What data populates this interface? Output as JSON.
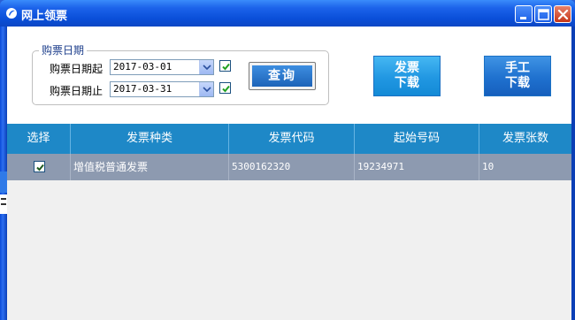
{
  "window": {
    "title": "网上领票",
    "controls": {
      "minimize": "minimize-icon",
      "maximize": "maximize-icon",
      "close": "close-icon"
    }
  },
  "purchase_date": {
    "legend": "购票日期",
    "start_label": "购票日期起",
    "start_value": "2017-03-01",
    "start_checked": true,
    "end_label": "购票日期止",
    "end_value": "2017-03-31",
    "end_checked": true,
    "query_label": "查询"
  },
  "actions": {
    "invoice_download_line1": "发票",
    "invoice_download_line2": "下载",
    "manual_download_line1": "手工",
    "manual_download_line2": "下载"
  },
  "table": {
    "columns": [
      "选择",
      "发票种类",
      "发票代码",
      "起始号码",
      "发票张数"
    ],
    "rows": [
      {
        "selected": true,
        "type": "增值税普通发票",
        "code": "5300162320",
        "start_no": "19234971",
        "count": "10"
      }
    ]
  },
  "colors": {
    "titlebar": "#0a4fd9",
    "header": "#1e88c7",
    "selected_row": "#8d9ab0",
    "accent_button": "#2197e2"
  }
}
